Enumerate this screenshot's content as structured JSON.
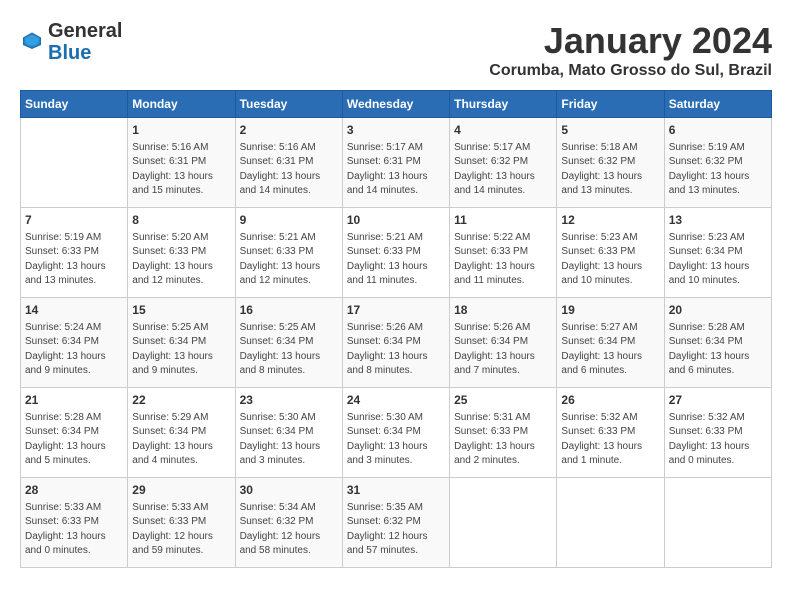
{
  "logo": {
    "general": "General",
    "blue": "Blue"
  },
  "header": {
    "title": "January 2024",
    "subtitle": "Corumba, Mato Grosso do Sul, Brazil"
  },
  "days_of_week": [
    "Sunday",
    "Monday",
    "Tuesday",
    "Wednesday",
    "Thursday",
    "Friday",
    "Saturday"
  ],
  "weeks": [
    [
      {
        "day": "",
        "info": ""
      },
      {
        "day": "1",
        "info": "Sunrise: 5:16 AM\nSunset: 6:31 PM\nDaylight: 13 hours\nand 15 minutes."
      },
      {
        "day": "2",
        "info": "Sunrise: 5:16 AM\nSunset: 6:31 PM\nDaylight: 13 hours\nand 14 minutes."
      },
      {
        "day": "3",
        "info": "Sunrise: 5:17 AM\nSunset: 6:31 PM\nDaylight: 13 hours\nand 14 minutes."
      },
      {
        "day": "4",
        "info": "Sunrise: 5:17 AM\nSunset: 6:32 PM\nDaylight: 13 hours\nand 14 minutes."
      },
      {
        "day": "5",
        "info": "Sunrise: 5:18 AM\nSunset: 6:32 PM\nDaylight: 13 hours\nand 13 minutes."
      },
      {
        "day": "6",
        "info": "Sunrise: 5:19 AM\nSunset: 6:32 PM\nDaylight: 13 hours\nand 13 minutes."
      }
    ],
    [
      {
        "day": "7",
        "info": "Sunrise: 5:19 AM\nSunset: 6:33 PM\nDaylight: 13 hours\nand 13 minutes."
      },
      {
        "day": "8",
        "info": "Sunrise: 5:20 AM\nSunset: 6:33 PM\nDaylight: 13 hours\nand 12 minutes."
      },
      {
        "day": "9",
        "info": "Sunrise: 5:21 AM\nSunset: 6:33 PM\nDaylight: 13 hours\nand 12 minutes."
      },
      {
        "day": "10",
        "info": "Sunrise: 5:21 AM\nSunset: 6:33 PM\nDaylight: 13 hours\nand 11 minutes."
      },
      {
        "day": "11",
        "info": "Sunrise: 5:22 AM\nSunset: 6:33 PM\nDaylight: 13 hours\nand 11 minutes."
      },
      {
        "day": "12",
        "info": "Sunrise: 5:23 AM\nSunset: 6:33 PM\nDaylight: 13 hours\nand 10 minutes."
      },
      {
        "day": "13",
        "info": "Sunrise: 5:23 AM\nSunset: 6:34 PM\nDaylight: 13 hours\nand 10 minutes."
      }
    ],
    [
      {
        "day": "14",
        "info": "Sunrise: 5:24 AM\nSunset: 6:34 PM\nDaylight: 13 hours\nand 9 minutes."
      },
      {
        "day": "15",
        "info": "Sunrise: 5:25 AM\nSunset: 6:34 PM\nDaylight: 13 hours\nand 9 minutes."
      },
      {
        "day": "16",
        "info": "Sunrise: 5:25 AM\nSunset: 6:34 PM\nDaylight: 13 hours\nand 8 minutes."
      },
      {
        "day": "17",
        "info": "Sunrise: 5:26 AM\nSunset: 6:34 PM\nDaylight: 13 hours\nand 8 minutes."
      },
      {
        "day": "18",
        "info": "Sunrise: 5:26 AM\nSunset: 6:34 PM\nDaylight: 13 hours\nand 7 minutes."
      },
      {
        "day": "19",
        "info": "Sunrise: 5:27 AM\nSunset: 6:34 PM\nDaylight: 13 hours\nand 6 minutes."
      },
      {
        "day": "20",
        "info": "Sunrise: 5:28 AM\nSunset: 6:34 PM\nDaylight: 13 hours\nand 6 minutes."
      }
    ],
    [
      {
        "day": "21",
        "info": "Sunrise: 5:28 AM\nSunset: 6:34 PM\nDaylight: 13 hours\nand 5 minutes."
      },
      {
        "day": "22",
        "info": "Sunrise: 5:29 AM\nSunset: 6:34 PM\nDaylight: 13 hours\nand 4 minutes."
      },
      {
        "day": "23",
        "info": "Sunrise: 5:30 AM\nSunset: 6:34 PM\nDaylight: 13 hours\nand 3 minutes."
      },
      {
        "day": "24",
        "info": "Sunrise: 5:30 AM\nSunset: 6:34 PM\nDaylight: 13 hours\nand 3 minutes."
      },
      {
        "day": "25",
        "info": "Sunrise: 5:31 AM\nSunset: 6:33 PM\nDaylight: 13 hours\nand 2 minutes."
      },
      {
        "day": "26",
        "info": "Sunrise: 5:32 AM\nSunset: 6:33 PM\nDaylight: 13 hours\nand 1 minute."
      },
      {
        "day": "27",
        "info": "Sunrise: 5:32 AM\nSunset: 6:33 PM\nDaylight: 13 hours\nand 0 minutes."
      }
    ],
    [
      {
        "day": "28",
        "info": "Sunrise: 5:33 AM\nSunset: 6:33 PM\nDaylight: 13 hours\nand 0 minutes."
      },
      {
        "day": "29",
        "info": "Sunrise: 5:33 AM\nSunset: 6:33 PM\nDaylight: 12 hours\nand 59 minutes."
      },
      {
        "day": "30",
        "info": "Sunrise: 5:34 AM\nSunset: 6:32 PM\nDaylight: 12 hours\nand 58 minutes."
      },
      {
        "day": "31",
        "info": "Sunrise: 5:35 AM\nSunset: 6:32 PM\nDaylight: 12 hours\nand 57 minutes."
      },
      {
        "day": "",
        "info": ""
      },
      {
        "day": "",
        "info": ""
      },
      {
        "day": "",
        "info": ""
      }
    ]
  ]
}
